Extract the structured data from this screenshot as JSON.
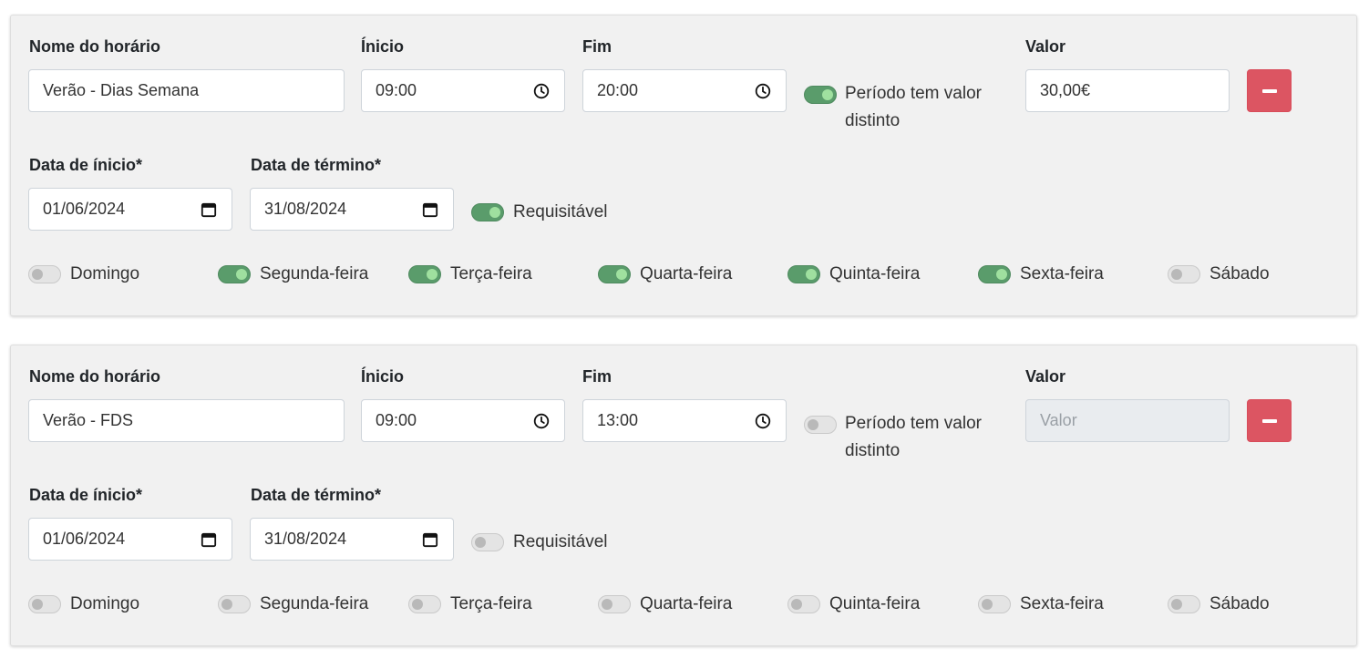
{
  "labels": {
    "name": "Nome do horário",
    "start": "Ínicio",
    "end": "Fim",
    "value": "Valor",
    "start_date": "Data de ínicio*",
    "end_date": "Data de término*",
    "distinct_value_line1": "Período tem valor",
    "distinct_value_line2": "distinto",
    "requestable": "Requisitável",
    "value_placeholder": "Valor"
  },
  "days": [
    "Domingo",
    "Segunda-feira",
    "Terça-feira",
    "Quarta-feira",
    "Quinta-feira",
    "Sexta-feira",
    "Sábado"
  ],
  "schedules": [
    {
      "name": "Verão - Dias Semana",
      "start_time": "09:00",
      "end_time": "20:00",
      "distinct_value": true,
      "value": "30,00€",
      "value_disabled": false,
      "start_date": "01/06/2024",
      "end_date": "31/08/2024",
      "requestable": true,
      "days_enabled": [
        false,
        true,
        true,
        true,
        true,
        true,
        false
      ]
    },
    {
      "name": "Verão - FDS",
      "start_time": "09:00",
      "end_time": "13:00",
      "distinct_value": false,
      "value": "",
      "value_disabled": true,
      "start_date": "01/06/2024",
      "end_date": "31/08/2024",
      "requestable": false,
      "days_enabled": [
        false,
        false,
        false,
        false,
        false,
        false,
        false
      ]
    }
  ],
  "colors": {
    "toggle_on": "#5a9c6b",
    "toggle_knob_on": "#9fe09f",
    "remove_button": "#dc5562",
    "card_background": "#f1f1f1"
  },
  "icons": {
    "time": "clock-icon",
    "date": "calendar-icon",
    "remove": "minus-icon"
  }
}
